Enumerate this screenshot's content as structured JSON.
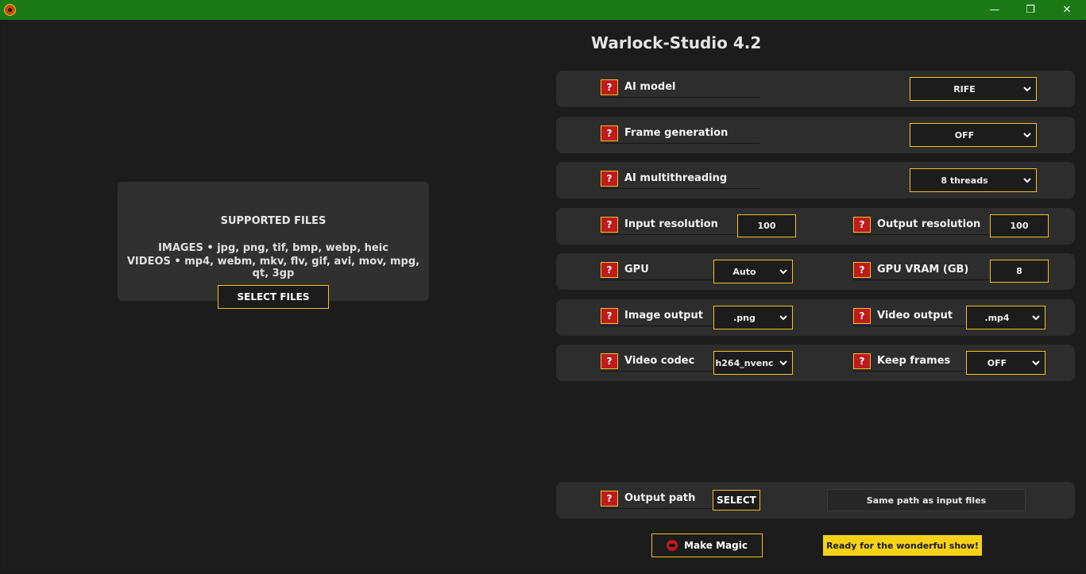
{
  "window": {
    "controls": {
      "minimize": "—",
      "maximize": "❐",
      "close": "✕"
    }
  },
  "app": {
    "title": "Warlock-Studio 4.2"
  },
  "dropzone": {
    "heading": "SUPPORTED FILES",
    "images_line": "IMAGES • jpg, png, tif, bmp, webp, heic",
    "videos_line": "VIDEOS • mp4, webm, mkv, flv, gif, avi, mov, mpg, qt, 3gp",
    "select_button": "SELECT FILES"
  },
  "help_glyph": "?",
  "settings": {
    "ai_model": {
      "label": "AI model",
      "value": "RIFE"
    },
    "frame_generation": {
      "label": "Frame generation",
      "value": "OFF"
    },
    "ai_multithreading": {
      "label": "AI multithreading",
      "value": "8 threads"
    },
    "input_resolution": {
      "label": "Input resolution",
      "value": "100"
    },
    "output_resolution": {
      "label": "Output resolution",
      "value": "100"
    },
    "gpu": {
      "label": "GPU",
      "value": "Auto"
    },
    "gpu_vram": {
      "label": "GPU VRAM (GB)",
      "value": "8"
    },
    "image_output": {
      "label": "Image output",
      "value": ".png"
    },
    "video_output": {
      "label": "Video output",
      "value": ".mp4"
    },
    "video_codec": {
      "label": "Video codec",
      "value": "h264_nvenc"
    },
    "keep_frames": {
      "label": "Keep frames",
      "value": "OFF"
    },
    "output_path": {
      "label": "Output path",
      "button": "SELECT",
      "value": "Same path as input files"
    }
  },
  "actions": {
    "make_magic": "Make Magic"
  },
  "status": {
    "message": "Ready for the wonderful show!"
  },
  "colors": {
    "titlebar": "#1b7a16",
    "accent": "#f2c21a",
    "help_red": "#bf1b1b",
    "status_bg": "#f5d21a"
  }
}
